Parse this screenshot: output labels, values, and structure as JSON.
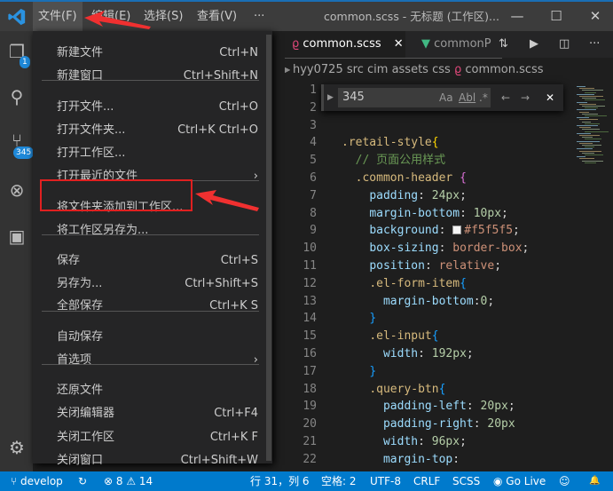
{
  "titlebar": {
    "menus": [
      "文件(F)",
      "编辑(E)",
      "选择(S)",
      "查看(V)",
      "···"
    ],
    "title": "common.scss - 无标题 (工作区)...",
    "min": "—",
    "max": "☐",
    "close": "✕"
  },
  "activity": {
    "explorer_badge": "1",
    "scm_badge": "345"
  },
  "tabs": [
    {
      "label": "common.scss",
      "close": "✕"
    },
    {
      "label": "commonP"
    }
  ],
  "breadcrumbs": [
    "hyy0725",
    "src",
    "cim",
    "assets",
    "css",
    "common.scss"
  ],
  "find": {
    "value": "345",
    "case": "Aa",
    "word": "Abl",
    "regex": ".*",
    "prev": "←",
    "next": "→",
    "close": "✕"
  },
  "file_menu": {
    "items": [
      {
        "label": "新建文件",
        "key": "Ctrl+N"
      },
      {
        "label": "新建窗口",
        "key": "Ctrl+Shift+N"
      },
      {
        "label": "打开文件...",
        "key": "Ctrl+O"
      },
      {
        "label": "打开文件夹...",
        "key": "Ctrl+K Ctrl+O"
      },
      {
        "label": "打开工作区...",
        "key": ""
      },
      {
        "label": "打开最近的文件",
        "key": "›"
      },
      {
        "label": "将文件夹添加到工作区...",
        "key": ""
      },
      {
        "label": "将工作区另存为...",
        "key": ""
      },
      {
        "label": "保存",
        "key": "Ctrl+S"
      },
      {
        "label": "另存为...",
        "key": "Ctrl+Shift+S"
      },
      {
        "label": "全部保存",
        "key": "Ctrl+K S"
      },
      {
        "label": "自动保存",
        "key": ""
      },
      {
        "label": "首选项",
        "key": "›"
      },
      {
        "label": "还原文件",
        "key": ""
      },
      {
        "label": "关闭编辑器",
        "key": "Ctrl+F4"
      },
      {
        "label": "关闭工作区",
        "key": "Ctrl+K F"
      },
      {
        "label": "关闭窗口",
        "key": "Ctrl+Shift+W"
      }
    ]
  },
  "code": [
    {
      "n": "1",
      "t": []
    },
    {
      "n": "2",
      "t": []
    },
    {
      "n": "3",
      "t": []
    },
    {
      "n": "4",
      "t": [
        [
          "sel",
          ".retail-style"
        ],
        [
          "br",
          "{"
        ]
      ]
    },
    {
      "n": "5",
      "t": [
        [
          "",
          "  "
        ],
        [
          "cm",
          "// 页面公用样式"
        ]
      ]
    },
    {
      "n": "6",
      "t": [
        [
          "",
          "  "
        ],
        [
          "sel",
          ".common-header "
        ],
        [
          "br2",
          "{"
        ]
      ]
    },
    {
      "n": "7",
      "t": [
        [
          "",
          "    "
        ],
        [
          "prop",
          "padding"
        ],
        [
          "",
          ": "
        ],
        [
          "num",
          "24px"
        ],
        [
          "",
          ";"
        ]
      ]
    },
    {
      "n": "8",
      "t": [
        [
          "",
          "    "
        ],
        [
          "prop",
          "margin-bottom"
        ],
        [
          "",
          ": "
        ],
        [
          "num",
          "10px"
        ],
        [
          "",
          ";"
        ]
      ]
    },
    {
      "n": "9",
      "t": [
        [
          "",
          "    "
        ],
        [
          "prop",
          "background"
        ],
        [
          "",
          ": "
        ],
        [
          "swatch",
          ""
        ],
        [
          "kw",
          "#f5f5f5"
        ],
        [
          "",
          ";"
        ]
      ]
    },
    {
      "n": "10",
      "t": [
        [
          "",
          "    "
        ],
        [
          "prop",
          "box-sizing"
        ],
        [
          "",
          ": "
        ],
        [
          "kw",
          "border-box"
        ],
        [
          "",
          ";"
        ]
      ]
    },
    {
      "n": "11",
      "t": [
        [
          "",
          "    "
        ],
        [
          "prop",
          "position"
        ],
        [
          "",
          ": "
        ],
        [
          "kw",
          "relative"
        ],
        [
          "",
          ";"
        ]
      ]
    },
    {
      "n": "12",
      "t": [
        [
          "",
          "    "
        ],
        [
          "sel",
          ".el-form-item"
        ],
        [
          "br3",
          "{"
        ]
      ]
    },
    {
      "n": "13",
      "t": [
        [
          "",
          "      "
        ],
        [
          "prop",
          "margin-bottom"
        ],
        [
          "",
          ":"
        ],
        [
          "num",
          "0"
        ],
        [
          "",
          ";"
        ]
      ]
    },
    {
      "n": "14",
      "t": [
        [
          "",
          "    "
        ],
        [
          "br3",
          "}"
        ]
      ]
    },
    {
      "n": "15",
      "t": [
        [
          "",
          "    "
        ],
        [
          "sel",
          ".el-input"
        ],
        [
          "br3",
          "{"
        ]
      ]
    },
    {
      "n": "16",
      "t": [
        [
          "",
          "      "
        ],
        [
          "prop",
          "width"
        ],
        [
          "",
          ": "
        ],
        [
          "num",
          "192px"
        ],
        [
          "",
          ";"
        ]
      ]
    },
    {
      "n": "17",
      "t": [
        [
          "",
          "    "
        ],
        [
          "br3",
          "}"
        ]
      ]
    },
    {
      "n": "18",
      "t": [
        [
          "",
          "    "
        ],
        [
          "sel",
          ".query-btn"
        ],
        [
          "br3",
          "{"
        ]
      ]
    },
    {
      "n": "19",
      "t": [
        [
          "",
          "      "
        ],
        [
          "prop",
          "padding-left"
        ],
        [
          "",
          ": "
        ],
        [
          "num",
          "20px"
        ],
        [
          "",
          ";"
        ]
      ]
    },
    {
      "n": "20",
      "t": [
        [
          "",
          "      "
        ],
        [
          "prop",
          "padding-right"
        ],
        [
          "",
          ": "
        ],
        [
          "num",
          "20px"
        ]
      ]
    },
    {
      "n": "21",
      "t": [
        [
          "",
          "      "
        ],
        [
          "prop",
          "width"
        ],
        [
          "",
          ": "
        ],
        [
          "num",
          "96px"
        ],
        [
          "",
          ";"
        ]
      ]
    },
    {
      "n": "22",
      "t": [
        [
          "",
          "      "
        ],
        [
          "prop",
          "margin-top"
        ],
        [
          "",
          ":"
        ]
      ]
    }
  ],
  "status": {
    "branch": "develop",
    "sync": "↻",
    "errors": "8",
    "warnings": "14",
    "position": "行 31，列 6",
    "spaces": "空格: 2",
    "encoding": "UTF-8",
    "eol": "CRLF",
    "language": "SCSS",
    "golive": "Go Live",
    "feedback": "☺",
    "bell": "🔔"
  }
}
